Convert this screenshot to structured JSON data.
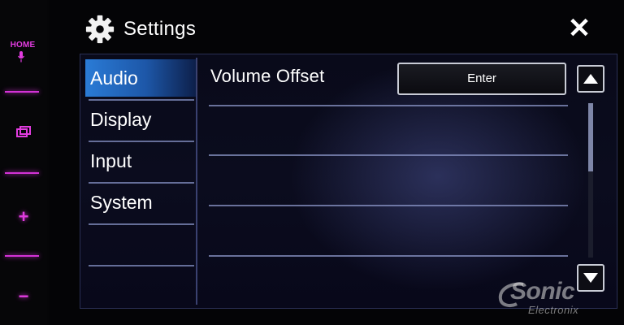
{
  "hardware": {
    "home_label": "HOME",
    "plus_label": "+",
    "minus_label": "−",
    "accent_color": "#e23ce0"
  },
  "header": {
    "title": "Settings",
    "close_label": "✕",
    "icon": "gear-icon"
  },
  "sidebar": {
    "items": [
      {
        "label": "Audio",
        "active": true
      },
      {
        "label": "Display",
        "active": false
      },
      {
        "label": "Input",
        "active": false
      },
      {
        "label": "System",
        "active": false
      }
    ]
  },
  "content": {
    "rows": [
      {
        "label": "Volume Offset",
        "button_label": "Enter"
      }
    ]
  },
  "scroll": {
    "up_icon": "triangle-up-icon",
    "down_icon": "triangle-down-icon"
  },
  "watermark": {
    "brand": "Sonic",
    "sub": "Electronix"
  }
}
